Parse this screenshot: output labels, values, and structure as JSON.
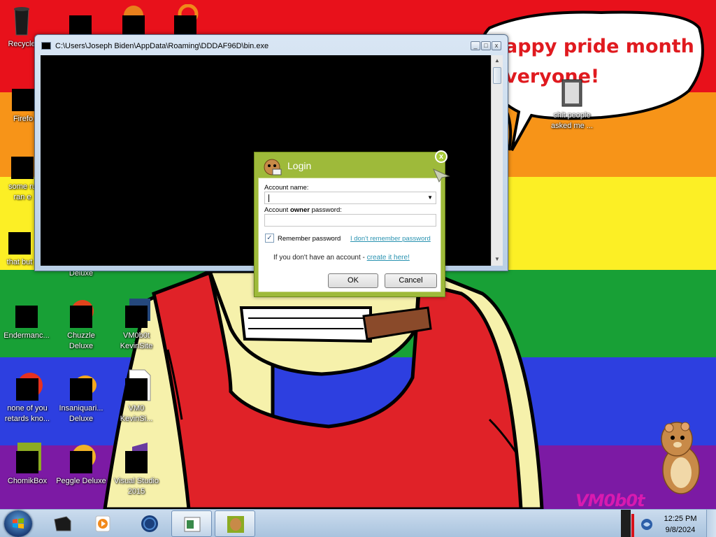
{
  "wallpaper": {
    "speech_line1": "appy pride month",
    "speech_line2": "veryone!",
    "watermark": "VM0b0t",
    "colors": [
      "#e8111b",
      "#f79418",
      "#fcef25",
      "#18a036",
      "#2d3fe0",
      "#7c1aa4"
    ]
  },
  "desktop_icons": [
    {
      "label": "Recycle",
      "icon": "recycle-bin-icon"
    },
    {
      "label": "Firefo",
      "icon": "firefox-icon"
    },
    {
      "label": "some ru\nran e",
      "icon": "file-icon"
    },
    {
      "label": "that but",
      "icon": "file-icon"
    },
    {
      "label": "Endermanc...",
      "icon": "console-icon"
    },
    {
      "label": "none of you\nretards kno...",
      "icon": "browser-icon"
    },
    {
      "label": "ChomikBox",
      "icon": "chomikbox-icon"
    },
    {
      "label": "Deluxe",
      "icon": "game-icon"
    },
    {
      "label": "Chuzzle\nDeluxe",
      "icon": "chuzzle-icon"
    },
    {
      "label": "Insaniquari...\nDeluxe",
      "icon": "insaniquarium-icon"
    },
    {
      "label": "Peggle Deluxe",
      "icon": "peggle-icon"
    },
    {
      "label": "VM0b0t\nKevinSite",
      "icon": "network-icon"
    },
    {
      "label": "VM0\nKevinSi...",
      "icon": "html-file-icon"
    },
    {
      "label": "Visual Studio\n2015",
      "icon": "visual-studio-icon"
    },
    {
      "label": "shit people\nasked me ...",
      "icon": "folder-icon"
    }
  ],
  "console": {
    "title": "C:\\Users\\Joseph Biden\\AppData\\Roaming\\DDDAF96D\\bin.exe",
    "minimize": "_",
    "restore": "□",
    "close": "x"
  },
  "login": {
    "title": "Login",
    "close": "x",
    "account_label": "Account name:",
    "account_value": "",
    "password_label_pre": "Account ",
    "password_label_bold": "owner",
    "password_label_post": " password:",
    "password_value": "",
    "remember_label": "Remember password",
    "remember_checked": true,
    "forgot_link": "I don't remember password",
    "signup_text": "If you don't have an account - ",
    "signup_link": "create it here!",
    "ok_label": "OK",
    "cancel_label": "Cancel"
  },
  "taskbar": {
    "items": [
      "console-window-icon",
      "media-player-icon",
      "browser-globe-icon",
      "console-app-icon",
      "chomikbox-icon"
    ],
    "clock_time": "12:25 PM",
    "clock_date": "9/8/2024"
  }
}
